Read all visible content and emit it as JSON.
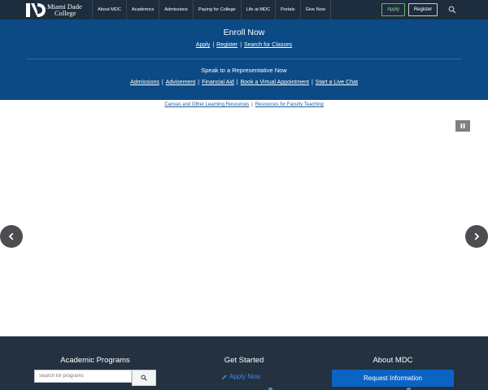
{
  "header": {
    "logo_line1": "Miami Dade",
    "logo_line2": "College",
    "nav": [
      "About MDC",
      "Academics",
      "Admissions",
      "Paying for College",
      "Life at MDC",
      "Portals",
      "Give Now"
    ],
    "apply_label": "Apply",
    "register_label": "Register",
    "search_icon": "search-icon"
  },
  "enroll": {
    "title": "Enroll Now",
    "links": [
      "Apply",
      "Register",
      "Search for Classes"
    ],
    "speak_title": "Speak to a Representative Now",
    "speak_links": [
      "Admissions",
      "Advisement",
      "Financial Aid",
      "Book a Virtual Appointment",
      "Start a Live Chat"
    ],
    "separator": "|"
  },
  "resources": {
    "links": [
      "Canvas and Other Learning Resources",
      "Resources for Faculty Teaching"
    ]
  },
  "carousel": {
    "pause_icon": "pause-icon",
    "prev_icon": "chevron-left-icon",
    "next_icon": "chevron-right-icon"
  },
  "footer": {
    "programs_title": "Academic Programs",
    "search_placeholder": "Search for programs",
    "get_started_title": "Get Started",
    "apply_now_label": "Apply Now",
    "about_title": "About MDC",
    "request_info_label": "Request Information"
  },
  "colors": {
    "nav_bg": "#1e2d3d",
    "banner_bg": "#0c4a85",
    "footer_bg": "#243140",
    "apply_green": "#62b66a",
    "link_blue": "#1d5c9c",
    "button_blue": "#0b64c4"
  }
}
